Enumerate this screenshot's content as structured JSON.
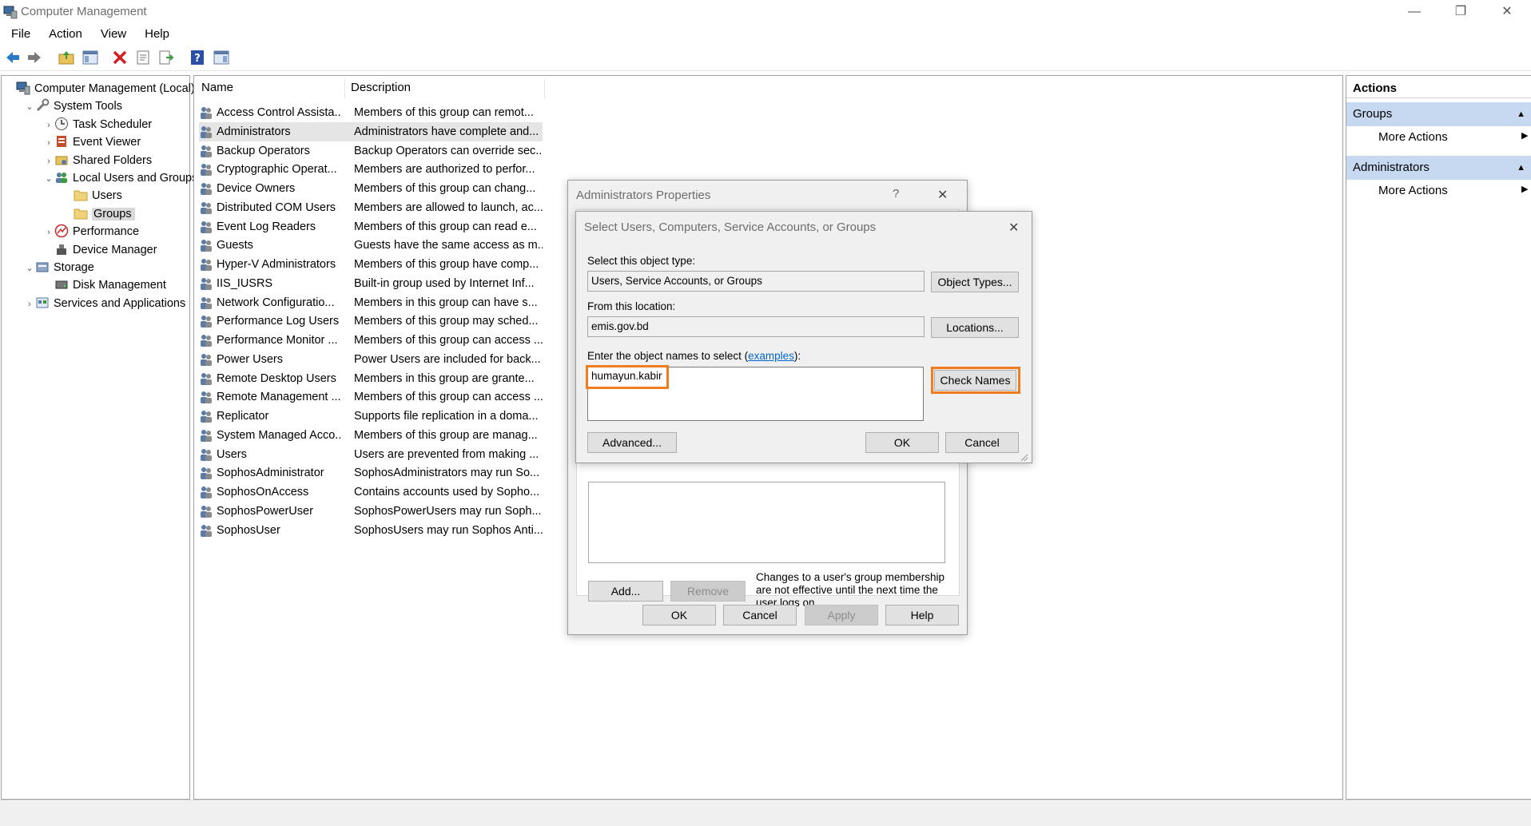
{
  "window": {
    "title": "Computer Management",
    "controls": {
      "minimize": "—",
      "restore": "❐",
      "close": "✕"
    }
  },
  "menu": [
    "File",
    "Action",
    "View",
    "Help"
  ],
  "toolbar": [
    "back-arrow-icon",
    "forward-arrow-icon",
    "up-folder-icon",
    "show-hide-tree-icon",
    "delete-icon",
    "properties-icon",
    "export-list-icon",
    "help-icon",
    "show-hide-action-pane-icon"
  ],
  "tree": [
    {
      "label": "Computer Management (Local)",
      "level": 0,
      "expander": "",
      "icon": "computer-icon"
    },
    {
      "label": "System Tools",
      "level": 1,
      "expander": "⌄",
      "icon": "tools-icon"
    },
    {
      "label": "Task Scheduler",
      "level": 2,
      "expander": "›",
      "icon": "clock-icon"
    },
    {
      "label": "Event Viewer",
      "level": 2,
      "expander": "›",
      "icon": "event-viewer-icon"
    },
    {
      "label": "Shared Folders",
      "level": 2,
      "expander": "›",
      "icon": "shared-folder-icon"
    },
    {
      "label": "Local Users and Groups",
      "level": 2,
      "expander": "⌄",
      "icon": "users-icon"
    },
    {
      "label": "Users",
      "level": 3,
      "expander": "",
      "icon": "folder-icon"
    },
    {
      "label": "Groups",
      "level": 3,
      "expander": "",
      "icon": "folder-icon",
      "selected": true
    },
    {
      "label": "Performance",
      "level": 2,
      "expander": "›",
      "icon": "performance-icon"
    },
    {
      "label": "Device Manager",
      "level": 2,
      "expander": "",
      "icon": "device-manager-icon"
    },
    {
      "label": "Storage",
      "level": 1,
      "expander": "⌄",
      "icon": "storage-icon"
    },
    {
      "label": "Disk Management",
      "level": 2,
      "expander": "",
      "icon": "disk-icon"
    },
    {
      "label": "Services and Applications",
      "level": 1,
      "expander": "›",
      "icon": "services-icon"
    }
  ],
  "list": {
    "columns": {
      "name": "Name",
      "description": "Description"
    },
    "rows": [
      {
        "name": "Access Control Assista...",
        "description": "Members of this group can remot..."
      },
      {
        "name": "Administrators",
        "description": "Administrators have complete and...",
        "selected": true
      },
      {
        "name": "Backup Operators",
        "description": "Backup Operators can override sec..."
      },
      {
        "name": "Cryptographic Operat...",
        "description": "Members are authorized to perfor..."
      },
      {
        "name": "Device Owners",
        "description": "Members of this group can chang..."
      },
      {
        "name": "Distributed COM Users",
        "description": "Members are allowed to launch, ac..."
      },
      {
        "name": "Event Log Readers",
        "description": "Members of this group can read e..."
      },
      {
        "name": "Guests",
        "description": "Guests have the same access as m..."
      },
      {
        "name": "Hyper-V Administrators",
        "description": "Members of this group have comp..."
      },
      {
        "name": "IIS_IUSRS",
        "description": "Built-in group used by Internet Inf..."
      },
      {
        "name": "Network Configuratio...",
        "description": "Members in this group can have s..."
      },
      {
        "name": "Performance Log Users",
        "description": "Members of this group may sched..."
      },
      {
        "name": "Performance Monitor ...",
        "description": "Members of this group can access ..."
      },
      {
        "name": "Power Users",
        "description": "Power Users are included for back..."
      },
      {
        "name": "Remote Desktop Users",
        "description": "Members in this group are grante..."
      },
      {
        "name": "Remote Management ...",
        "description": "Members of this group can access ..."
      },
      {
        "name": "Replicator",
        "description": "Supports file replication in a doma..."
      },
      {
        "name": "System Managed Acco...",
        "description": "Members of this group are manag..."
      },
      {
        "name": "Users",
        "description": "Users are prevented from making ..."
      },
      {
        "name": "SophosAdministrator",
        "description": "SophosAdministrators may run So..."
      },
      {
        "name": "SophosOnAccess",
        "description": "Contains accounts used by Sopho..."
      },
      {
        "name": "SophosPowerUser",
        "description": "SophosPowerUsers may run Soph..."
      },
      {
        "name": "SophosUser",
        "description": "SophosUsers may run Sophos Anti..."
      }
    ]
  },
  "actions": {
    "title": "Actions",
    "sections": [
      {
        "title": "Groups",
        "item": "More Actions"
      },
      {
        "title": "Administrators",
        "item": "More Actions"
      }
    ]
  },
  "admin_props": {
    "title": "Administrators Properties",
    "help": "?",
    "close": "✕",
    "note": "Changes to a user's group membership are not effective until the next time the user logs on.",
    "add": "Add...",
    "remove": "Remove",
    "ok": "OK",
    "cancel": "Cancel",
    "apply": "Apply",
    "help_btn": "Help"
  },
  "select_dialog": {
    "title": "Select Users, Computers, Service Accounts, or Groups",
    "close": "✕",
    "object_type_label": "Select this object type:",
    "object_type_value": "Users, Service Accounts, or Groups",
    "object_types_btn": "Object Types...",
    "location_label": "From this location:",
    "location_value": "emis.gov.bd",
    "locations_btn": "Locations...",
    "names_label_prefix": "Enter the object names to select (",
    "names_label_link": "examples",
    "names_label_suffix": "):",
    "names_value": "humayun.kabir",
    "check_names_btn": "Check Names",
    "advanced_btn": "Advanced...",
    "ok": "OK",
    "cancel": "Cancel"
  },
  "colors": {
    "highlight": "#ef7d1f",
    "action_section": "#c6d9f0",
    "link": "#0066cc"
  }
}
